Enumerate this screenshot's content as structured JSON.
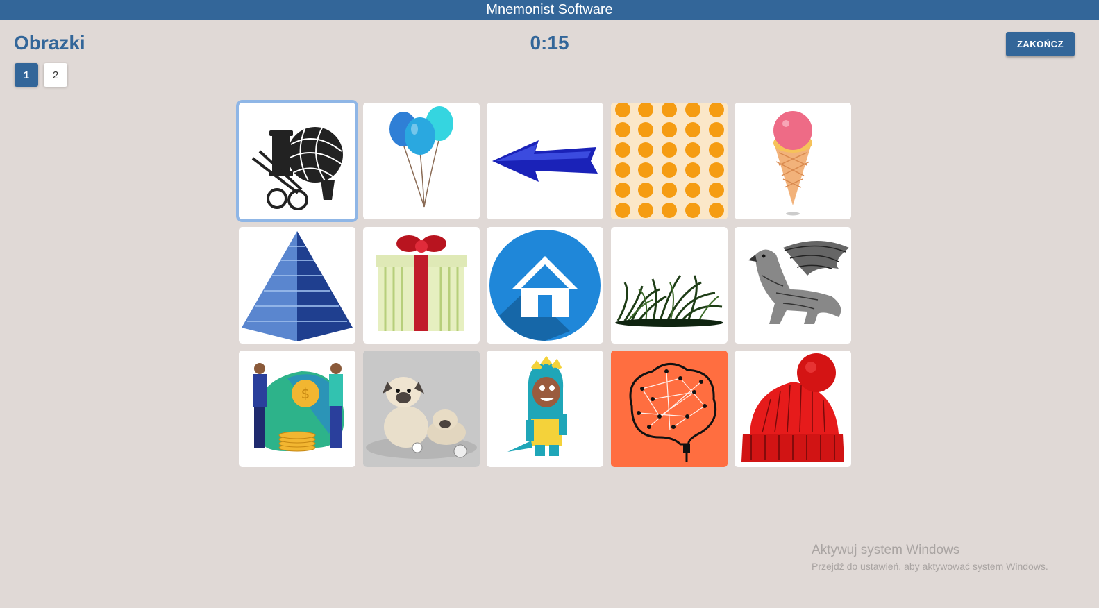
{
  "app": {
    "title": "Mnemonist Software"
  },
  "header": {
    "title": "Obrazki",
    "timer": "0:15",
    "finish_label": "ZAKOŃCZ"
  },
  "pages": [
    "1",
    "2"
  ],
  "active_page": "1",
  "tiles": [
    {
      "icon": "sewing-supplies-icon"
    },
    {
      "icon": "balloons-icon"
    },
    {
      "icon": "left-arrow-icon"
    },
    {
      "icon": "oranges-pattern-icon"
    },
    {
      "icon": "ice-cream-icon"
    },
    {
      "icon": "pyramid-icon"
    },
    {
      "icon": "gift-box-icon"
    },
    {
      "icon": "home-icon"
    },
    {
      "icon": "grass-bush-icon"
    },
    {
      "icon": "griffin-icon"
    },
    {
      "icon": "money-exchange-icon"
    },
    {
      "icon": "pug-dogs-icon"
    },
    {
      "icon": "dino-costume-kid-icon"
    },
    {
      "icon": "brain-network-icon"
    },
    {
      "icon": "knit-hat-icon"
    }
  ],
  "selected_tile": 0,
  "colors": {
    "primary": "#336699",
    "background": "#e0d9d6",
    "selected_border": "#8fb6e6"
  },
  "watermark": {
    "line1": "Aktywuj system Windows",
    "line2": "Przejdź do ustawień, aby aktywować system Windows."
  }
}
